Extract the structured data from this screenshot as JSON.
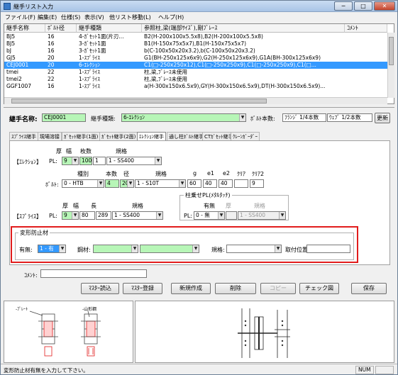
{
  "window": {
    "title": "継手リスト入力",
    "min": "─",
    "max": "□",
    "close": "✕"
  },
  "menu": [
    "ファイル(F)",
    "編集(E)",
    "仕様(S)",
    "表示(V)",
    "他リスト移動(L)",
    "ヘルプ(H)"
  ],
  "list": {
    "columns": [
      "継手名称",
      "ﾎﾞﾙﾄ径",
      "継手種類",
      "参照柱,梁(端部ｻｲｽﾞ),剛ﾌﾞﾚｰｽ",
      "ｺﾒﾝﾄ"
    ],
    "rows": [
      [
        "BJ5",
        "16",
        "4-ｶﾞｾｯﾄ1面(片刃...",
        "B2(H-200x100x5.5x8),B2(H-200x100x5.5x8)"
      ],
      [
        "BJ5",
        "16",
        "3-ｶﾞｾｯﾄ1面",
        "B1(H-150x75x5x7),B1(H-150x75x5x7)"
      ],
      [
        "bJ",
        "16",
        "3-ｶﾞｾｯﾄ1面",
        "b(C-100x50x20x3.2),b(C-100x50x20x3.2)"
      ],
      [
        "GJ5",
        "20",
        "1-ｽﾌﾟﾗｲｽ",
        "G1(BH-250x125x6x9),G2(H-250x125x6x9),G1A(BH-300x125x6x9)"
      ],
      [
        "CEJ0001",
        "20",
        "6-ｴﾚｸｼｮﾝ",
        "C1(□-250x250x12),C1(□-250x250x9),C1(□-250x250x9),C1(□..."
      ],
      [
        "tmei",
        "22",
        "1-ｽﾌﾟﾗｲｽ",
        "柱,梁,ﾌﾞﾚｰｽ未使用"
      ],
      [
        "tmei2",
        "22",
        "1-ｽﾌﾟﾗｲｽ",
        "柱,梁,ﾌﾞﾚｰｽ未使用"
      ],
      [
        "GGF1007",
        "16",
        "1-ｽﾌﾟﾗｲｽ",
        "a(H-300x150x6.5x9),GY(H-300x150x6.5x9),DT(H-300x150x6.5x9)..."
      ]
    ],
    "selected_row": 4
  },
  "form": {
    "name_label": "継手名称:",
    "name_value": "CEJ0001",
    "type_label": "継手種類:",
    "type_value": "6-ｴﾚｸｼｮﾝ",
    "bolt_count_label": "ﾎﾞﾙﾄ本数:",
    "flange_value": "ﾌﾗﾝｼﾞ 1/4本数",
    "web_value": "ｳｪﾌﾞ  1/2本数",
    "update_button": "更新"
  },
  "tabs": [
    "ｽﾌﾟﾗｲｽ継手",
    "現場溶接",
    "ｶﾞｾｯﾄ継手(1面)",
    "ｶﾞｾｯﾄ継手(2面)",
    "ｴﾚｸｼｮﾝ継手",
    "通し柱ﾎﾞﾙﾄ継手",
    "CTｶﾞｾｯﾄ継手",
    "ｸﾚｰﾝｶﾞｰﾀﾞｰ"
  ],
  "active_tab": 4,
  "erection": {
    "h_thick": "厚",
    "h_width": "幅",
    "h_count": "枚数",
    "h_spec": "規格",
    "section": "【ｴﾚｸｼｮﾝ】",
    "pl_label": "PL:",
    "thick": "9",
    "width": "100",
    "count": "1",
    "spec": "1 - SS400"
  },
  "bolt": {
    "h_type": "種別",
    "h_count": "本数",
    "h_dia": "径",
    "h_spec": "規格",
    "h_g": "g",
    "h_e1": "e1",
    "h_e2": "e2",
    "h_clear": "ｸﾘｱ",
    "h_clear2": "ｸﾘｱ2",
    "label": "ﾎﾞﾙﾄ:",
    "type": "0 - HTB",
    "count": "4",
    "dia": "20",
    "spec": "1 - S10T",
    "g": "60",
    "e1": "40",
    "e2": "40",
    "clear": "",
    "clear2": "9"
  },
  "splice": {
    "h_thick": "厚",
    "h_width": "幅",
    "h_len": "長",
    "h_spec": "規格",
    "section": "【ｽﾌﾟﾗｲｽ】",
    "pl_label": "PL:",
    "thick": "9",
    "width": "80",
    "len": "289",
    "spec": "1 - SS400"
  },
  "stack": {
    "title": "柱乗せPL(ﾒﾀﾙﾀｯﾁ)",
    "h_has": "有無",
    "h_thick": "厚",
    "h_spec": "規格",
    "pl_label": "PL:",
    "has": "0 - 無",
    "thick": "",
    "spec": "1 - SS400"
  },
  "deform": {
    "title": "変形防止材",
    "has_label": "有無:",
    "has_value": "1 - 有",
    "steel_label": "鋼材:",
    "spec_label": "規格:",
    "pos_label": "取付位置:"
  },
  "comment_label": "ｺﾒﾝﾄ:",
  "buttons": {
    "master_read": "ﾏｽﾀｰ読込",
    "master_reg": "ﾏｽﾀｰ登録",
    "new": "新規作成",
    "delete": "削除",
    "copy": "コピー",
    "check": "チェック図",
    "save": "保存"
  },
  "sketch": {
    "plate_label": "-ﾌﾟﾚｰﾄ",
    "stiff_label": "-山形鋼"
  },
  "status": {
    "message": "変形防止材有無を入力して下さい。",
    "num": "NUM"
  },
  "colors": {
    "selection": "#3399ff",
    "input_green": "#b7f6b7",
    "highlight": "#e11c1c"
  }
}
